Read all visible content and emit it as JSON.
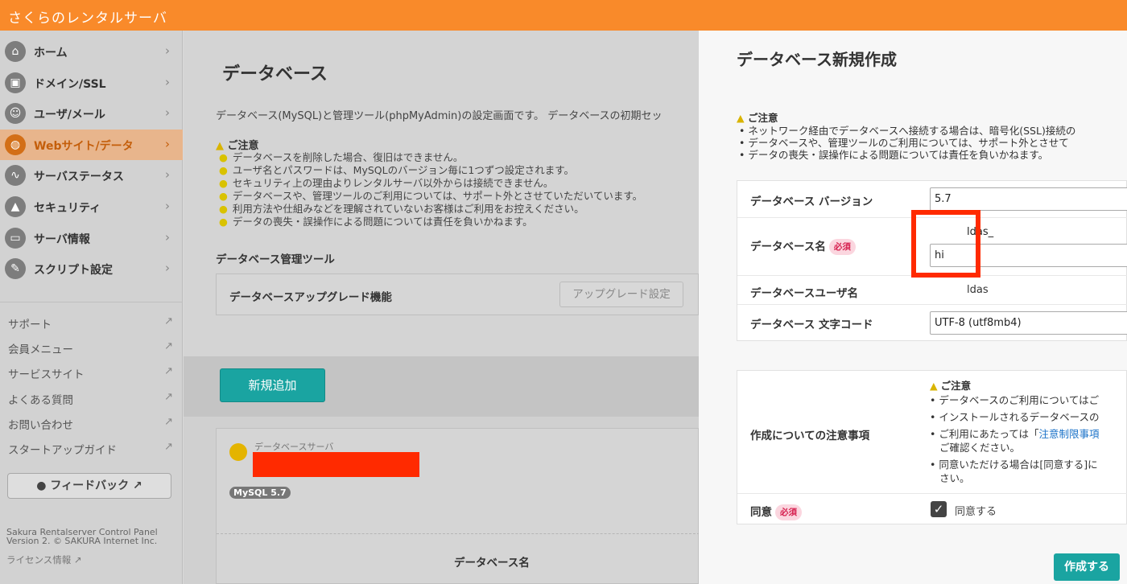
{
  "app": {
    "brand": "さくらのレンタルサーバ"
  },
  "sidebar": {
    "nav": [
      {
        "label": "ホーム",
        "icon": "home-icon",
        "glyph": "⌂"
      },
      {
        "label": "ドメイン/SSL",
        "icon": "lock-icon",
        "glyph": "▣"
      },
      {
        "label": "ユーザ/メール",
        "icon": "user-icon",
        "glyph": "☺"
      },
      {
        "label": "Webサイト/データ",
        "icon": "globe-icon",
        "glyph": "◍"
      },
      {
        "label": "サーバステータス",
        "icon": "chart-icon",
        "glyph": "∿"
      },
      {
        "label": "セキュリティ",
        "icon": "padlock-icon",
        "glyph": "▲"
      },
      {
        "label": "サーバ情報",
        "icon": "server-icon",
        "glyph": "▭"
      },
      {
        "label": "スクリプト設定",
        "icon": "script-icon",
        "glyph": "✎"
      }
    ],
    "links": [
      {
        "label": "サポート"
      },
      {
        "label": "会員メニュー"
      },
      {
        "label": "サービスサイト"
      },
      {
        "label": "よくある質問"
      },
      {
        "label": "お問い合わせ"
      },
      {
        "label": "スタートアップガイド"
      }
    ],
    "feedback": "フィードバック",
    "footer_line1": "Sakura Rentalserver Control Panel",
    "footer_line2": "Version 2. © SAKURA Internet Inc.",
    "license": "ライセンス情報"
  },
  "main": {
    "title": "データベース",
    "description": "データベース(MySQL)と管理ツール(phpMyAdmin)の設定画面です。 データベースの初期セッ",
    "caution_title": "ご注意",
    "cautions": [
      "データベースを削除した場合、復旧はできません。",
      "ユーザ名とパスワードは、MySQLのバージョン毎に1つずつ設定されます。",
      "セキュリティ上の理由よりレンタルサーバ以外からは接続できません。",
      "データベースや、管理ツールのご利用については、サポート外とさせていただいています。",
      "利用方法や仕組みなどを理解されていないお客様はご利用をお控えください。",
      "データの喪失・誤操作による問題については責任を負いかねます。"
    ],
    "tools_title": "データベース管理ツール",
    "upgrade_label": "データベースアップグレード機能",
    "upgrade_button": "アップグレード設定",
    "add_button": "新規追加",
    "server_label": "データベースサーバ",
    "mysql_badge": "MySQL 5.7",
    "dbname_header": "データベース名"
  },
  "panel": {
    "title": "データベース新規作成",
    "caution_title": "ご注意",
    "cautions": [
      "ネットワーク経由でデータベースへ接続する場合は、暗号化(SSL)接続の",
      "データベースや、管理ツールのご利用については、サポート外とさせて",
      "データの喪失・誤操作による問題については責任を負いかねます。"
    ],
    "version_label": "データベース バージョン",
    "version_value": "5.7",
    "dbname_label": "データベース名",
    "required": "必須",
    "dbname_prefix": "ldas_",
    "dbname_value": "hi",
    "dbuser_label": "データベースユーザ名",
    "dbuser_value": "ldas",
    "charset_label": "データベース 文字コード",
    "charset_value": "UTF-8 (utf8mb4)",
    "notes_label": "作成についての注意事項",
    "notes_title": "ご注意",
    "notes": {
      "n1": "データベースのご利用についてはご",
      "n2": "インストールされるデータベースの",
      "n3_pre": "ご利用にあたっては「",
      "n3_link": "注意制限事項",
      "n3_cont": "ご確認ください。",
      "n4": "同意いただける場合は[同意する]に",
      "n4_cont": "さい。"
    },
    "agree_label": "同意",
    "agree_text": "同意する",
    "create_button": "作成する"
  },
  "colors": {
    "brand": "#f98a2a",
    "accent": "#1aa4a1",
    "required": "#d6204f"
  }
}
